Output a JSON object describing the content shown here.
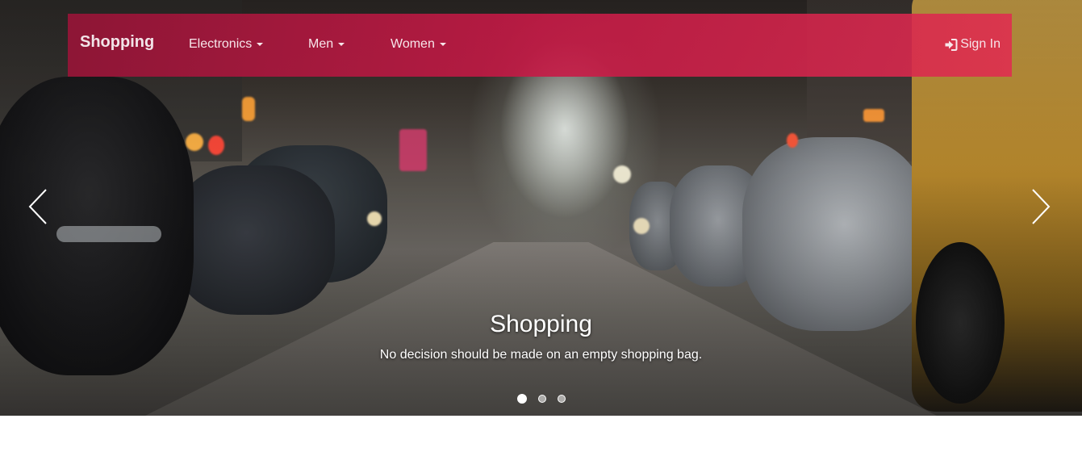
{
  "navbar": {
    "brand": "Shopping",
    "menu": [
      {
        "label": "Electronics",
        "has_dropdown": true
      },
      {
        "label": "Men",
        "has_dropdown": true
      },
      {
        "label": "Women",
        "has_dropdown": true
      }
    ],
    "sign_in": {
      "label": "Sign In",
      "icon": "sign-in-icon"
    },
    "gradient_colors": [
      "#96143a",
      "#c61a46",
      "#e02c50"
    ]
  },
  "carousel": {
    "slide_caption": {
      "title": "Shopping",
      "subtitle": "No decision should be made on an empty shopping bag."
    },
    "indicator_count": 3,
    "active_index": 0,
    "prev_icon": "chevron-left-icon",
    "next_icon": "chevron-right-icon"
  }
}
